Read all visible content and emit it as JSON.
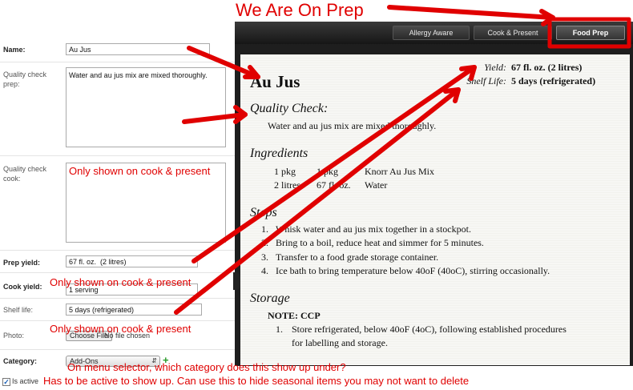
{
  "annotations": {
    "headline": "We Are On Prep",
    "cook_only_1": "Only shown on cook & present",
    "cook_only_2": "Only shown on cook & present",
    "cook_only_3": "Only shown on cook & present",
    "menu_question": "On menu selector, which category does this show up under?",
    "active_note": "Has to be active to show up. Can use this to hide seasonal items you may not want to delete",
    "color": "#e00000"
  },
  "form": {
    "name_label": "Name:",
    "name_value": "Au Jus",
    "qc_prep_label": "Quality check prep:",
    "qc_prep_value": "Water and au jus mix are mixed thoroughly.",
    "qc_cook_label": "Quality check cook:",
    "qc_cook_value": "",
    "prep_yield_label": "Prep yield:",
    "prep_yield_value": "67 fl. oz.  (2 litres)",
    "cook_yield_label": "Cook yield:",
    "cook_yield_value": "1 serving",
    "shelf_life_label": "Shelf life:",
    "shelf_life_value": "5 days (refrigerated)",
    "photo_label": "Photo:",
    "choose_file_label": "Choose File",
    "no_file_text": "No file chosen",
    "category_label": "Category:",
    "category_value": "Add-Ons",
    "add_icon": "plus-icon",
    "is_active_label": "Is active",
    "is_active_checked": true
  },
  "nav": {
    "tabs": [
      {
        "label": "Allergy Aware",
        "active": false
      },
      {
        "label": "Cook & Present",
        "active": false
      },
      {
        "label": "Food Prep",
        "active": true
      }
    ]
  },
  "recipe": {
    "title": "Au Jus",
    "yield_label": "Yield:",
    "yield_value": "67 fl. oz. (2 litres)",
    "shelf_label": "Shelf Life:",
    "shelf_value": "5 days (refrigerated)",
    "qc_heading": "Quality Check:",
    "qc_text": "Water and au jus mix are mixed thoroughly.",
    "ingredients_heading": "Ingredients",
    "ingredients": [
      {
        "qty1": "1 pkg",
        "qty2": "1 pkg",
        "name": "Knorr Au Jus Mix"
      },
      {
        "qty1": "2 litres",
        "qty2": "67 fl. oz.",
        "name": "Water"
      }
    ],
    "steps_heading": "Steps",
    "steps": [
      {
        "num": "1.",
        "text": "Whisk water and au jus mix together in a stockpot."
      },
      {
        "num": "2.",
        "text": "Bring to a boil, reduce heat and simmer for 5 minutes."
      },
      {
        "num": "3.",
        "text": "Transfer to a food grade storage container."
      },
      {
        "num": "4.",
        "text": "Ice bath to bring temperature below 40oF (40oC), stirring occasionally."
      }
    ],
    "storage_heading": "Storage",
    "storage_note": "NOTE: CCP",
    "storage_items": [
      {
        "num": "1.",
        "line1": "Store refrigerated, below 40oF (4oC), following established procedures",
        "line2": "for labelling and storage."
      }
    ]
  }
}
